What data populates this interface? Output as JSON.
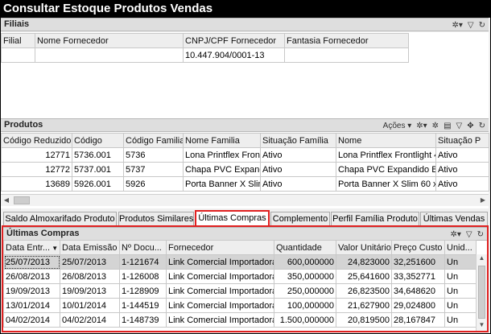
{
  "window": {
    "title": "Consultar Estoque Produtos Vendas"
  },
  "filiais": {
    "title": "Filiais",
    "columns": [
      "Filial",
      "Nome Fornecedor",
      "CNPJ/CPF Fornecedor",
      "Fantasia Fornecedor"
    ],
    "rows": [
      [
        "",
        "",
        "10.447.904/0001-13",
        ""
      ]
    ]
  },
  "produtos": {
    "title": "Produtos",
    "acoes_label": "Ações",
    "columns": [
      "Código Reduzido",
      "Código",
      "Código Familia",
      "Nome Familia",
      "Situação Família",
      "Nome",
      "Situação P"
    ],
    "rows": [
      [
        "12771",
        "5736.001",
        "5736",
        "Lona Printflex Frontl",
        "Ativo",
        "Lona Printflex Frontlight 4(",
        "Ativo"
      ],
      [
        "12772",
        "5737.001",
        "5737",
        "Chapa PVC Expand",
        "Ativo",
        "Chapa PVC Expandido Br",
        "Ativo"
      ],
      [
        "13689",
        "5926.001",
        "5926",
        "Porta Banner X Slim",
        "Ativo",
        "Porta Banner X Slim 60 x 1",
        "Ativo"
      ]
    ]
  },
  "tabs": [
    {
      "label": "Saldo Almoxarifado Produto",
      "active": false
    },
    {
      "label": "Produtos Similares",
      "active": false
    },
    {
      "label": "Últimas Compras",
      "active": true
    },
    {
      "label": "Complemento",
      "active": false
    },
    {
      "label": "Perfil Família Produto",
      "active": false
    },
    {
      "label": "Últimas Vendas",
      "active": false
    }
  ],
  "ultimas_compras": {
    "title": "Últimas Compras",
    "columns": [
      "Data Entr...",
      "Data Emissão",
      "Nº Docu...",
      "Fornecedor",
      "Quantidade",
      "Valor Unitário",
      "Preço Custo",
      "Unid..."
    ],
    "rows": [
      [
        "25/07/2013",
        "25/07/2013",
        "1-121674",
        "Link Comercial Importadora",
        "600,000000",
        "24,823000",
        "32,251600",
        "Un"
      ],
      [
        "26/08/2013",
        "26/08/2013",
        "1-126008",
        "Link Comercial Importadora",
        "350,000000",
        "25,641600",
        "33,352771",
        "Un"
      ],
      [
        "19/09/2013",
        "19/09/2013",
        "1-128909",
        "Link Comercial Importadora",
        "250,000000",
        "26,823500",
        "34,648620",
        "Un"
      ],
      [
        "13/01/2014",
        "10/01/2014",
        "1-144519",
        "Link Comercial Importadora",
        "100,000000",
        "21,627900",
        "29,024800",
        "Un"
      ],
      [
        "04/02/2014",
        "04/02/2014",
        "1-148739",
        "Link Comercial Importadora",
        "1.500,000000",
        "20,819500",
        "28,167847",
        "Un"
      ]
    ]
  },
  "colors": {
    "highlight": "#e02020",
    "header_bg": "#dedede",
    "selected_row": "#d4d4d4"
  }
}
